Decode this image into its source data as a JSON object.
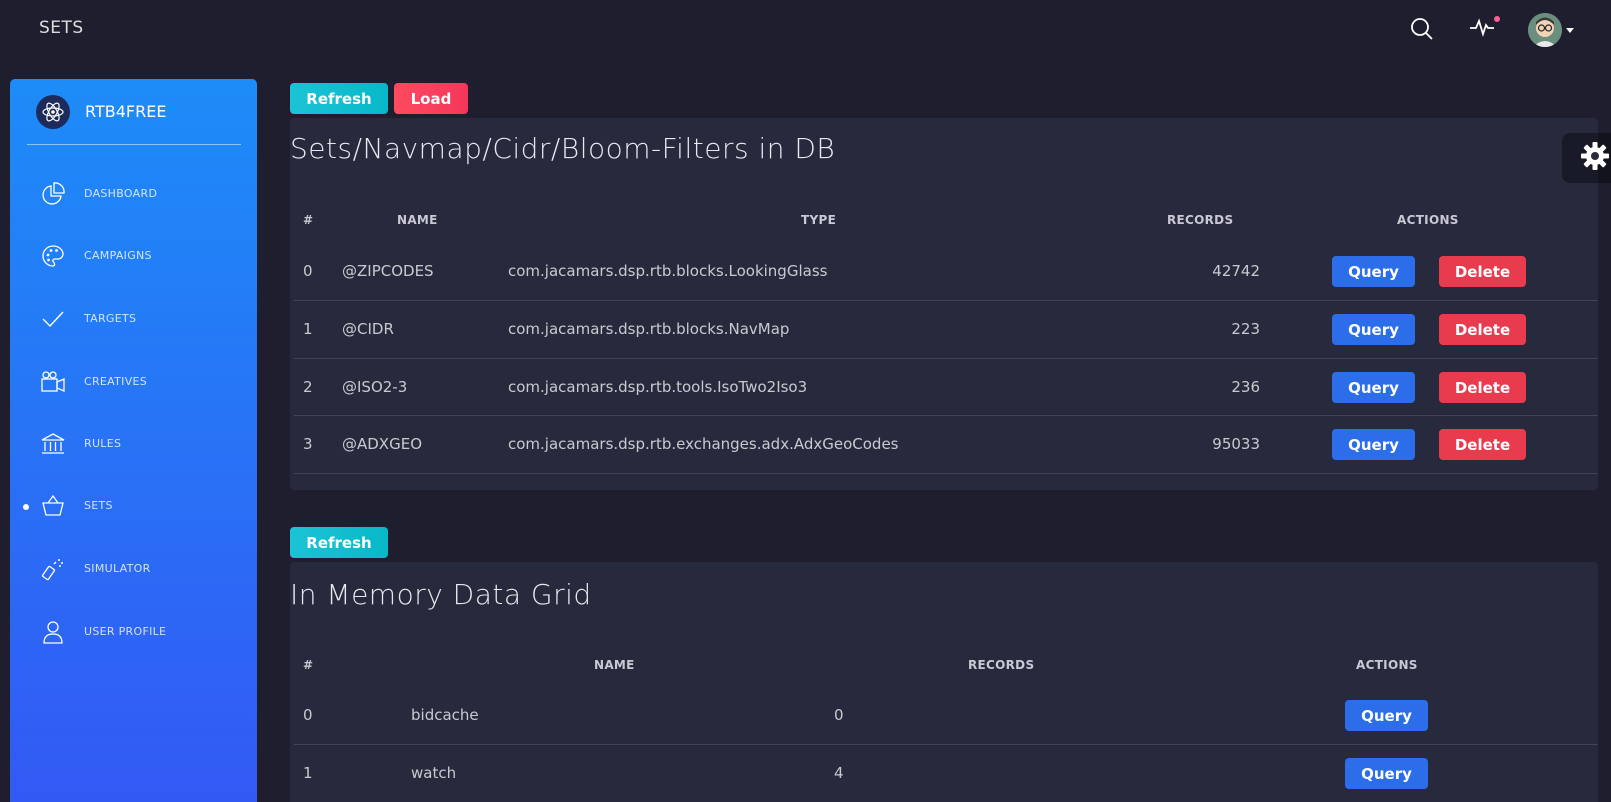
{
  "navbar": {
    "brand": "SETS"
  },
  "sidebar": {
    "title": "RTB4FREE",
    "items": [
      {
        "label": "DASHBOARD",
        "icon": "pie-chart-icon"
      },
      {
        "label": "CAMPAIGNS",
        "icon": "palette-icon"
      },
      {
        "label": "TARGETS",
        "icon": "check-icon"
      },
      {
        "label": "CREATIVES",
        "icon": "video-camera-icon"
      },
      {
        "label": "RULES",
        "icon": "bank-icon"
      },
      {
        "label": "SETS",
        "icon": "basket-icon",
        "active": true
      },
      {
        "label": "SIMULATOR",
        "icon": "spray-icon"
      },
      {
        "label": "USER PROFILE",
        "icon": "user-icon"
      }
    ]
  },
  "db_section": {
    "refresh_label": "Refresh",
    "load_label": "Load",
    "title": "Sets/Navmap/Cidr/Bloom-Filters in DB",
    "headers": {
      "index": "#",
      "name": "NAME",
      "type": "TYPE",
      "records": "RECORDS",
      "actions": "ACTIONS"
    },
    "rows": [
      {
        "index": "0",
        "name": "@ZIPCODES",
        "type": "com.jacamars.dsp.rtb.blocks.LookingGlass",
        "records": "42742",
        "query": "Query",
        "delete": "Delete"
      },
      {
        "index": "1",
        "name": "@CIDR",
        "type": "com.jacamars.dsp.rtb.blocks.NavMap",
        "records": "223",
        "query": "Query",
        "delete": "Delete"
      },
      {
        "index": "2",
        "name": "@ISO2-3",
        "type": "com.jacamars.dsp.rtb.tools.IsoTwo2Iso3",
        "records": "236",
        "query": "Query",
        "delete": "Delete"
      },
      {
        "index": "3",
        "name": "@ADXGEO",
        "type": "com.jacamars.dsp.rtb.exchanges.adx.AdxGeoCodes",
        "records": "95033",
        "query": "Query",
        "delete": "Delete"
      }
    ]
  },
  "grid_section": {
    "refresh_label": "Refresh",
    "title": "In Memory Data Grid",
    "headers": {
      "index": "#",
      "name": "NAME",
      "records": "RECORDS",
      "actions": "ACTIONS"
    },
    "rows": [
      {
        "index": "0",
        "name": "bidcache",
        "records": "0",
        "query": "Query"
      },
      {
        "index": "1",
        "name": "watch",
        "records": "4",
        "query": "Query"
      }
    ]
  },
  "colors": {
    "background": "#1e1e2f",
    "card": "#27293d",
    "sidebar_top": "#1d8cf8",
    "sidebar_bottom": "#3358f4",
    "info": "#1bc3d6",
    "danger": "#f5365c",
    "primary": "#2c6eea"
  }
}
